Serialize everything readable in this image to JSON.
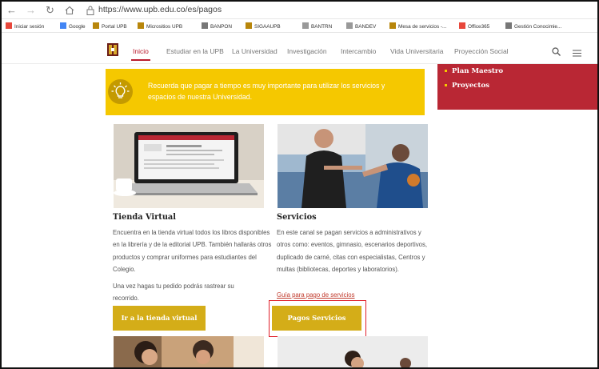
{
  "browser": {
    "url": "https://www.upb.edu.co/es/pagos",
    "bookmarks": [
      {
        "label": "Iniciar sesión",
        "icon": "windows-icon",
        "color": "#e8473b"
      },
      {
        "label": "Google",
        "icon": "google-icon",
        "color": "#4285f4"
      },
      {
        "label": "Portal UPB",
        "icon": "upb-icon",
        "color": "#b8860b"
      },
      {
        "label": "Micrositios UPB",
        "icon": "upb-icon",
        "color": "#b8860b"
      },
      {
        "label": "BANPON",
        "icon": "page-icon",
        "color": "#777777"
      },
      {
        "label": "SIGAAUPB",
        "icon": "upb-icon",
        "color": "#b8860b"
      },
      {
        "label": "BANTRN",
        "icon": "image-icon",
        "color": "#999999"
      },
      {
        "label": "BANDEV",
        "icon": "image-icon",
        "color": "#999999"
      },
      {
        "label": "Mesa de servicios -...",
        "icon": "upb-icon",
        "color": "#b8860b"
      },
      {
        "label": "Office365",
        "icon": "office-icon",
        "color": "#e8473b"
      },
      {
        "label": "Gestión Conocimie...",
        "icon": "page-icon",
        "color": "#777777"
      }
    ]
  },
  "nav": {
    "items": [
      "Inicio",
      "Estudiar en la UPB",
      "La Universidad",
      "Investigación",
      "Intercambio",
      "Vida Universitaria",
      "Proyección Social"
    ],
    "active_index": 0
  },
  "notice": {
    "text": "Recuerda que pagar a tiempo es muy importante para utilizar los servicios y espacios de nuestra Universidad."
  },
  "side_links": [
    "Plan Maestro",
    "Proyectos"
  ],
  "cards": [
    {
      "title": "Tienda Virtual",
      "text": "Encuentra en la tienda virtual todos los libros disponibles en la librería y de la editorial UPB. También hallarás otros productos y comprar uniformes para estudiantes del Colegio.",
      "extra": "Una vez hagas tu pedido podrás rastrear su recorrido.",
      "button": "Ir a la tienda virtual"
    },
    {
      "title": "Servicios",
      "text": "En este canal se pagan servicios a administrativos y otros como: eventos, gimnasio, escenarios deportivos, duplicado de carné, citas con especialistas, Centros y multas (bibliotecas, deportes y laboratorios).",
      "link": "Guía para pago de servicios",
      "button": "Pagos Servicios"
    }
  ],
  "colors": {
    "brand_red": "#b92734",
    "brand_yellow": "#f5c800",
    "button_gold": "#d4ad18",
    "highlight": "#e0202a"
  }
}
